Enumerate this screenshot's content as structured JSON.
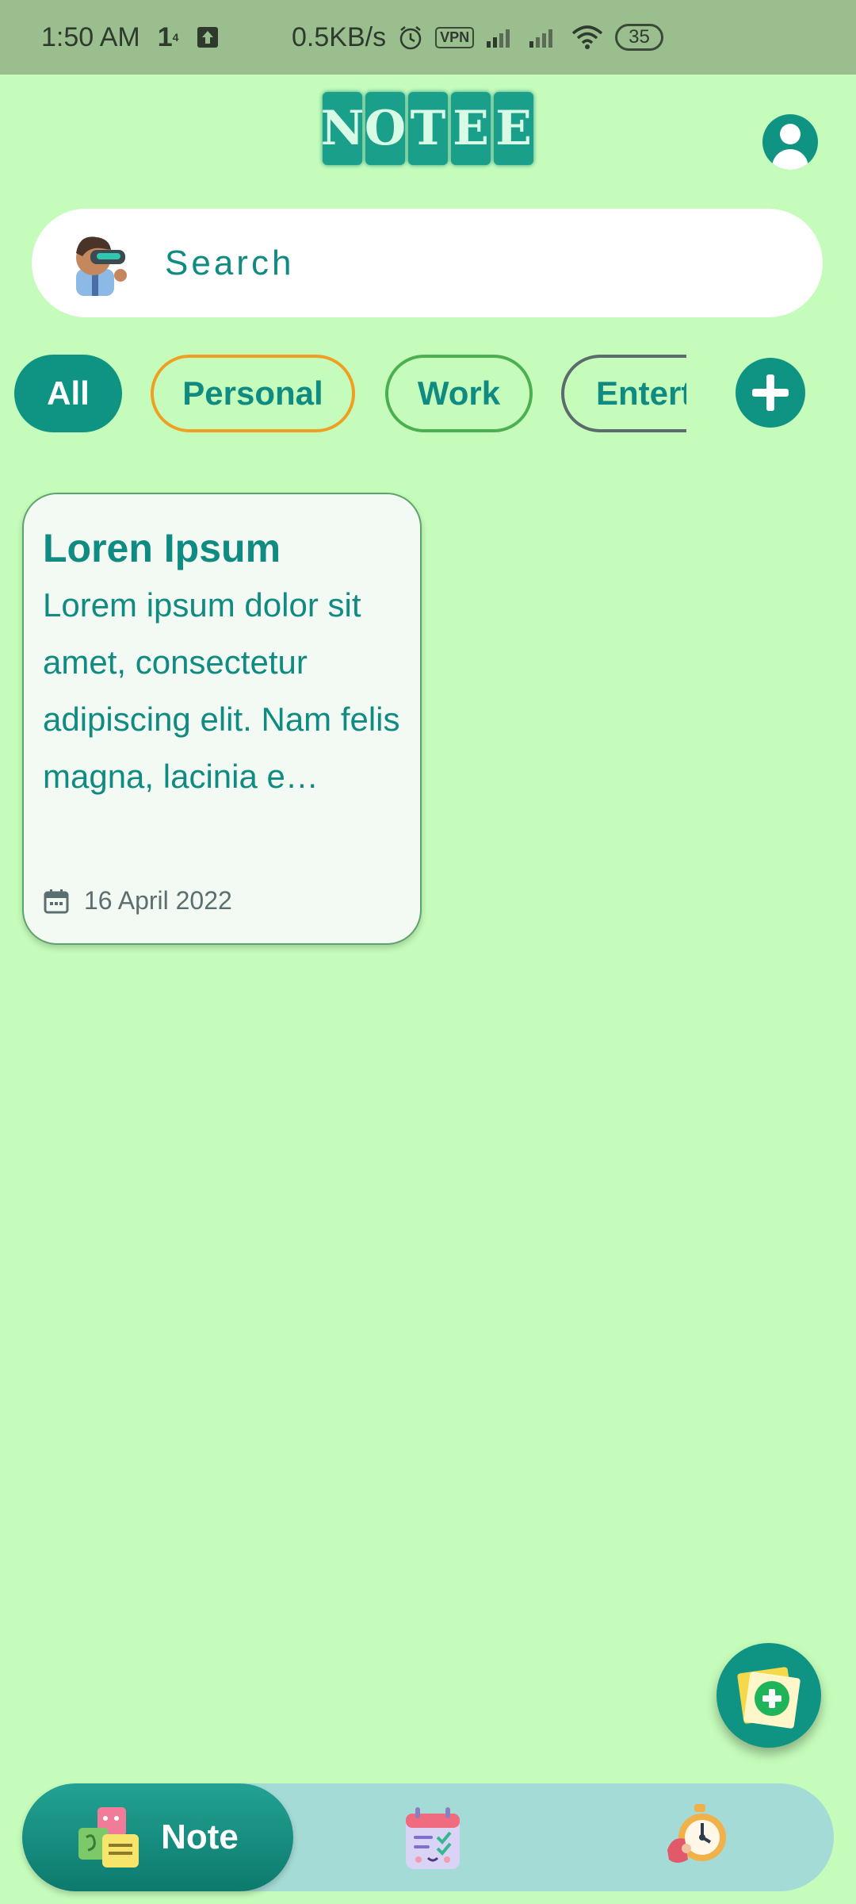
{
  "status_bar": {
    "time": "1:50 AM",
    "net_speed": "0.5KB/s",
    "vpn": "VPN",
    "battery": "35"
  },
  "app": {
    "logo_letters": [
      "N",
      "O",
      "T",
      "E",
      "E"
    ]
  },
  "search": {
    "placeholder": "Search"
  },
  "categories": [
    {
      "label": "All",
      "active": true
    },
    {
      "label": "Personal",
      "active": false
    },
    {
      "label": "Work",
      "active": false
    },
    {
      "label": "Entert",
      "active": false
    }
  ],
  "notes": [
    {
      "title": "Loren Ipsum",
      "body": "Lorem ipsum dolor sit amet, consectetur adipiscing elit. Nam felis magna, lacinia e…",
      "date": "16 April 2022"
    }
  ],
  "bottom_nav": {
    "items": [
      {
        "label": "Note",
        "icon": "sticky-notes-icon",
        "active": true
      },
      {
        "label": "",
        "icon": "task-calendar-icon",
        "active": false
      },
      {
        "label": "",
        "icon": "stopwatch-icon",
        "active": false
      }
    ]
  },
  "colors": {
    "background": "#c5fcbb",
    "primary": "#0f9484",
    "personal_border": "#f0a020",
    "work_border": "#4caf50"
  }
}
